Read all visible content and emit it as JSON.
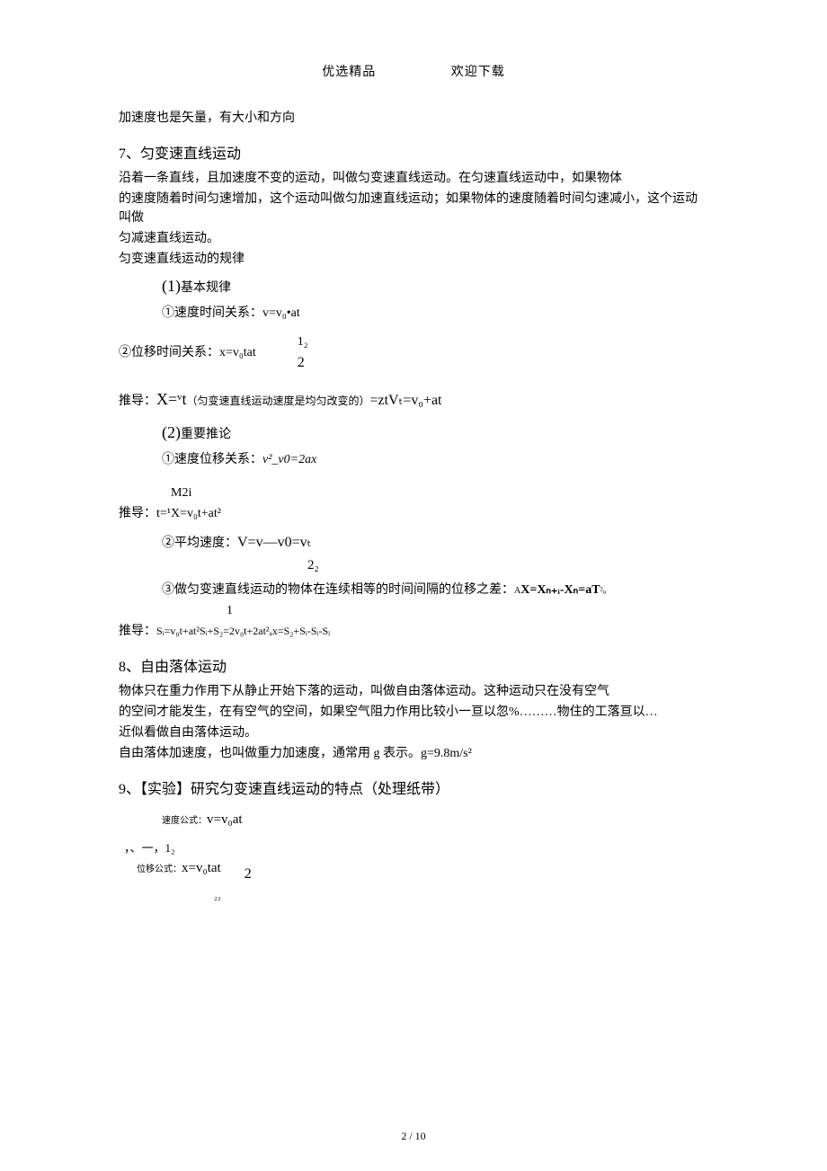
{
  "header": {
    "left": "优选精品",
    "right": "欢迎下载"
  },
  "p0": "加速度也是矢量，有大小和方向",
  "s7": {
    "title": "7、匀变速直线运动",
    "p1": "沿着一条直线，且加速度不变的运动，叫做匀变速直线运动。在匀速直线运动中，如果物体",
    "p2": "的速度随着时间匀速增加，这个运动叫做匀加速直线运动；如果物体的速度随着时间匀速减小，这个运动叫做",
    "p3": "匀减速直线运动。",
    "p4": "匀变速直线运动的规律",
    "b1_prefix": "(1)",
    "b1_rest": "基本规律",
    "l1": "①速度时间关系：v=v₀•at",
    "l2_left": "②位移时间关系：x=v₀tat",
    "l2_top": "1₂",
    "l2_bot": "2",
    "l3_pre": "推导：",
    "l3_x": "X=",
    "l3_vt": "ᵛt",
    "l3_note": "（匀变速直线运动速度是均匀改变的）",
    "l3_eq": "=ztVₜ=v₀+at",
    "b2_prefix": "(2)",
    "b2_rest": "重要推论",
    "l4_pre": "①速度位移关系：",
    "l4_eq": "v²_v0=2ax",
    "l5_top": "M2i",
    "l5_main": "推导：t=¹X=v₀t+at²",
    "l6_pre": "②平均速度：",
    "l6_main": "V=v—v0=vₜ",
    "l6_bot": "2₂",
    "l7_pre": "③做匀变速直线运动的物体在连续相等的时间间隔的位移之差：",
    "l7_eq_a": "A",
    "l7_eq_b": "X=Xₙ₊ᵢ-Xₙ=aT",
    "l7_eq_c": "²。",
    "l7_one": "1",
    "l8_pre": "推导：",
    "l8_eq": "Sᵢ=v₀t+at²Sᵢ+S₂=2v₀t+2at²ₐx=S₂+Sᵢ-Sᵢ-Sᵢ"
  },
  "s8": {
    "title": "8、自由落体运动",
    "p1": "物体只在重力作用下从静止开始下落的运动，叫做自由落体运动。这种运动只在没有空气",
    "p2": "的空间才能发生，在有空气的空间，如果空气阻力作用比较小一亘以忽%………物住的工落亘以…",
    "p3": "近似看做自由落体运动。",
    "p4": "自由落体加速度，也叫做重力加速度，通常用 g 表示。g=9.8m/s²"
  },
  "s9": {
    "title": "9、【实验】研究匀变速直线运动的特点（处理纸带）",
    "l1_pre": "速度公式：",
    "l1_eq": "v=v₀at",
    "l2_top": "，、一，1₂",
    "l2_pre": "位移公式：",
    "l2_eq": "x=v₀tat",
    "l2_two": "2",
    "l2_22": "₂₂"
  },
  "footer": "2 / 10"
}
